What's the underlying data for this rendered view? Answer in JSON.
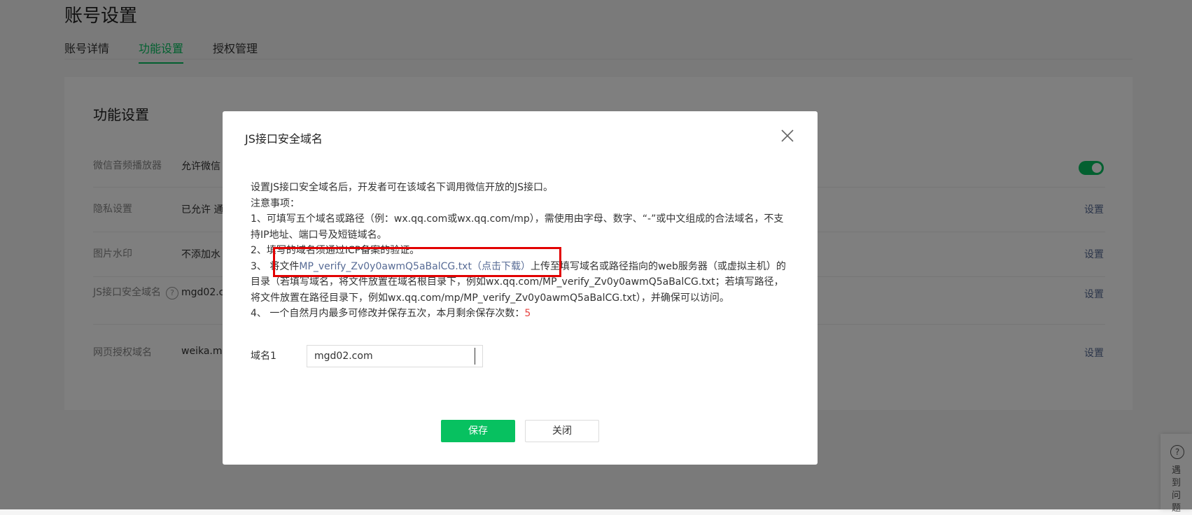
{
  "page": {
    "title": "账号设置",
    "tabs": [
      {
        "label": "账号详情",
        "active": false
      },
      {
        "label": "功能设置",
        "active": true
      },
      {
        "label": "授权管理",
        "active": false
      }
    ]
  },
  "card": {
    "title": "功能设置",
    "rows": [
      {
        "label": "微信音频播放器",
        "value": "允许微信",
        "action": ""
      },
      {
        "label": "隐私设置",
        "value": "已允许 通",
        "action": "设置"
      },
      {
        "label": "图片水印",
        "value": "不添加水",
        "action": "设置"
      },
      {
        "label": "JS接口安全域名",
        "value": "mgd02.c",
        "action": "设置"
      },
      {
        "label": "网页授权域名",
        "value": "weika.mu",
        "action": "设置"
      }
    ]
  },
  "help_float": {
    "text": "遇到问题"
  },
  "dialog": {
    "title": "JS接口安全域名",
    "intro": "设置JS接口安全域名后，开发者可在该域名下调用微信开放的JS接口。",
    "notes_title": "注意事项：",
    "note1_line1": "1、可填写五个域名或路径（例：wx.qq.com或wx.qq.com/mp），需使用由字母、数字、“-”或中文组成的合法域名，不支",
    "note1_line2": "持IP地址、端口号及短链域名。",
    "note2": "2、填写的域名须通过ICP备案的验证。",
    "note3_prefix": "3、 将文件",
    "note3_link": "MP_verify_Zv0y0awmQ5aBalCG.txt（点击下载）",
    "note3_suffix": "上传至填写域名或路径指向的web服务器（或虚拟主机）的",
    "note3_line2": "目录（若填写域名，将文件放置在域名根目录下，例如wx.qq.com/MP_verify_Zv0y0awmQ5aBalCG.txt；若填写路径，",
    "note3_line3": "将文件放置在路径目录下，例如wx.qq.com/mp/MP_verify_Zv0y0awmQ5aBalCG.txt），并确保可以访问。",
    "note4_prefix": "4、 一个自然月内最多可修改并保存五次，本月剩余保存次数：",
    "note4_count": "5",
    "field_label": "域名1",
    "field_value": "mgd02.com",
    "save_label": "保存",
    "close_label": "关闭"
  },
  "colors": {
    "accent": "#07c160",
    "link": "#576b95",
    "count": "#e64340",
    "highlight": "#e20000"
  }
}
